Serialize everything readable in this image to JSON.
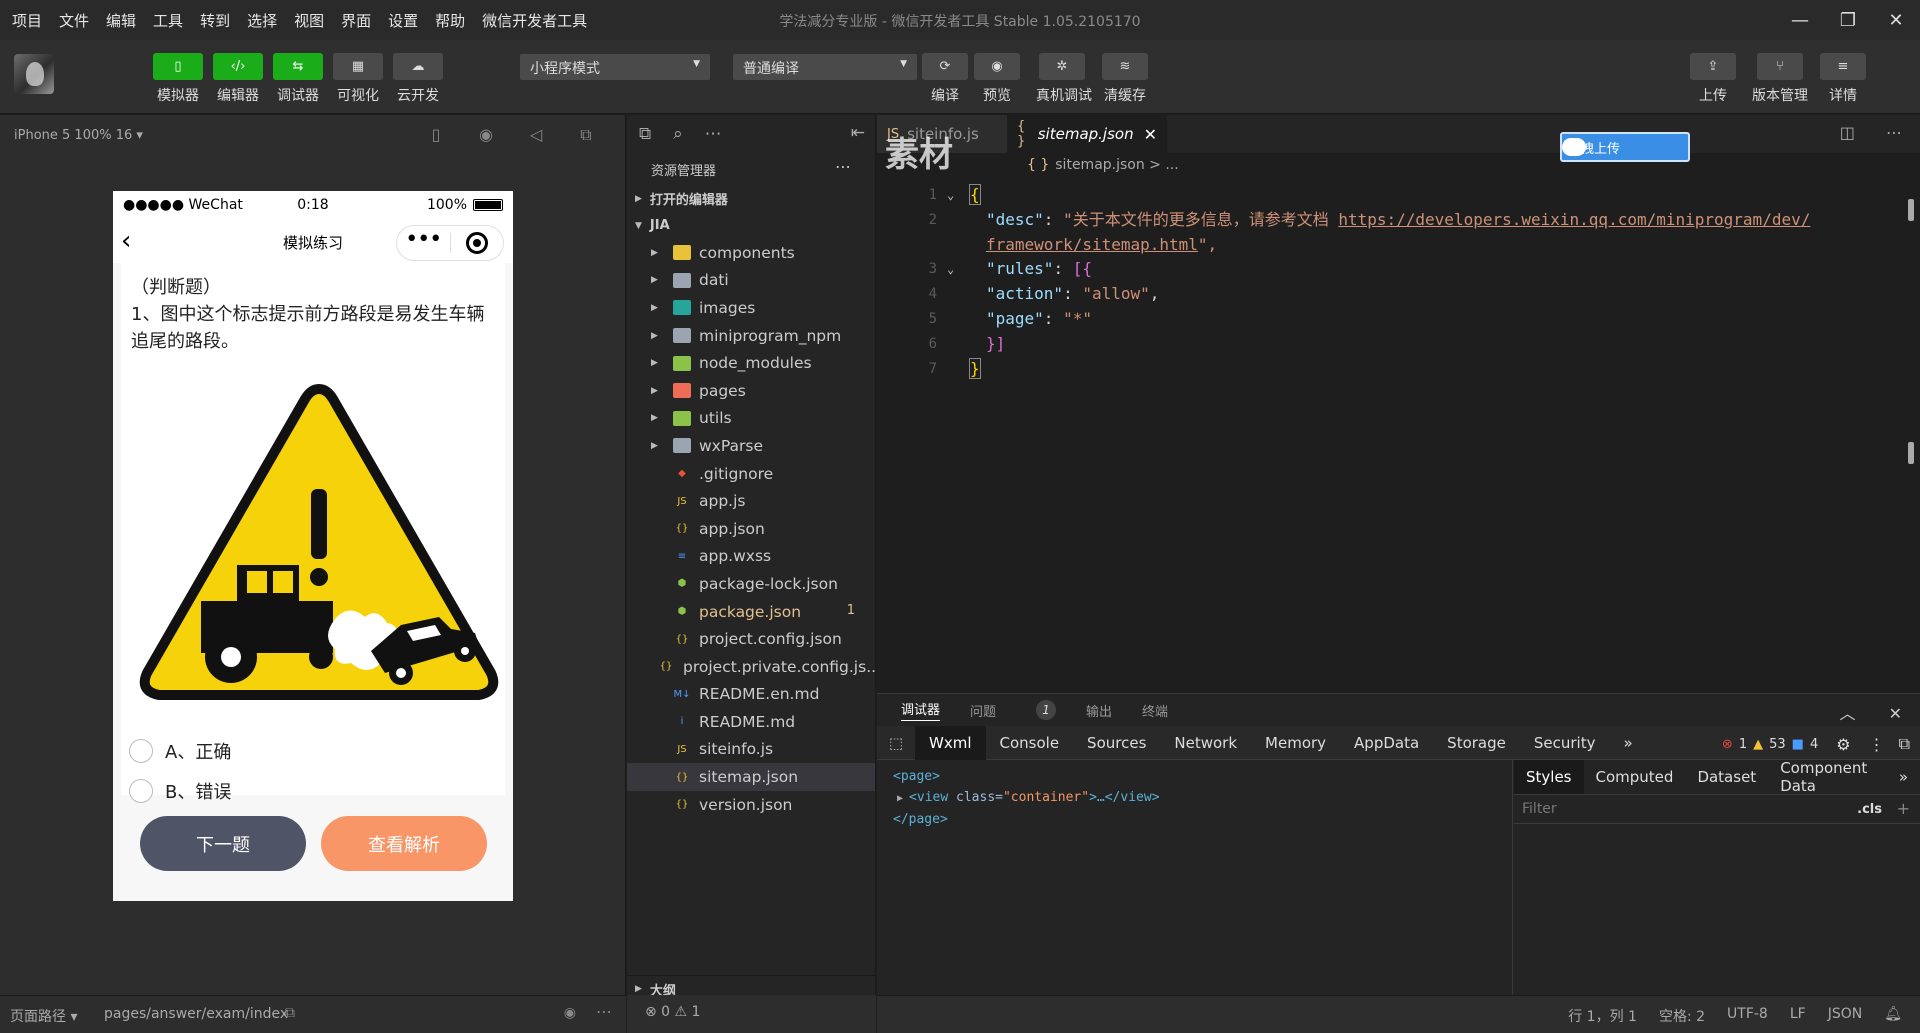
{
  "menubar": {
    "items": [
      "项目",
      "文件",
      "编辑",
      "工具",
      "转到",
      "选择",
      "视图",
      "界面",
      "设置",
      "帮助",
      "微信开发者工具"
    ],
    "window_title": "学法减分专业版 - 微信开发者工具 Stable 1.05.2105170",
    "controls": {
      "minimize": "—",
      "maximize": "❐",
      "close": "✕"
    }
  },
  "toolbar": {
    "buttons": [
      {
        "label": "模拟器",
        "icon": "phone-icon",
        "glyph": "▯"
      },
      {
        "label": "编辑器",
        "icon": "code-icon",
        "glyph": "‹/›"
      },
      {
        "label": "调试器",
        "icon": "debug-icon",
        "glyph": "⇆"
      },
      {
        "label": "可视化",
        "icon": "layout-icon",
        "glyph": "▦"
      },
      {
        "label": "云开发",
        "icon": "cloud-icon",
        "glyph": "☁"
      }
    ],
    "mode_select": "小程序模式",
    "compile_select": "普通编译",
    "actions": [
      {
        "label": "编译",
        "icon": "refresh-icon",
        "glyph": "⟳"
      },
      {
        "label": "预览",
        "icon": "eye-icon",
        "glyph": "◉"
      },
      {
        "label": "真机调试",
        "icon": "bug-icon",
        "glyph": "✲"
      },
      {
        "label": "清缓存",
        "icon": "layers-icon",
        "glyph": "≋"
      }
    ],
    "right_actions": [
      {
        "label": "上传",
        "icon": "upload-icon",
        "glyph": "⇪"
      },
      {
        "label": "版本管理",
        "icon": "branch-icon",
        "glyph": "⑂"
      },
      {
        "label": "详情",
        "icon": "menu-icon",
        "glyph": "≡"
      }
    ]
  },
  "simulator": {
    "device": "iPhone 5 100% 16 ▾",
    "status": {
      "carrier": "●●●●● WeChat",
      "time": "0:18",
      "battery": "100%"
    },
    "nav_title": "模拟练习",
    "question_type": "（判断题）",
    "question": "1、图中这个标志提示前方路段是易发生车辆追尾的路段。",
    "options": [
      "A、正确",
      "B、错误"
    ],
    "next_button": "下一题",
    "analysis_button": "查看解析",
    "footer": {
      "path_label": "页面路径 ▾",
      "path": "pages/answer/exam/index"
    }
  },
  "explorer": {
    "title": "资源管理器",
    "open_editors": "打开的编辑器",
    "project": "JIA",
    "files": [
      {
        "name": "components",
        "type": "folder",
        "color": "#e8c33a"
      },
      {
        "name": "dati",
        "type": "folder",
        "color": "#9aa5b1"
      },
      {
        "name": "images",
        "type": "folder",
        "color": "#26a69a"
      },
      {
        "name": "miniprogram_npm",
        "type": "folder",
        "color": "#9aa5b1"
      },
      {
        "name": "node_modules",
        "type": "folder",
        "color": "#8bc34a"
      },
      {
        "name": "pages",
        "type": "folder",
        "color": "#ef6c57"
      },
      {
        "name": "utils",
        "type": "folder",
        "color": "#8bc34a"
      },
      {
        "name": "wxParse",
        "type": "folder",
        "color": "#9aa5b1"
      },
      {
        "name": ".gitignore",
        "type": "file",
        "color": "#e8533a",
        "glyph": "◆"
      },
      {
        "name": "app.js",
        "type": "file",
        "color": "#e8c33a",
        "glyph": "JS"
      },
      {
        "name": "app.json",
        "type": "file",
        "color": "#e8c33a",
        "glyph": "{}"
      },
      {
        "name": "app.wxss",
        "type": "file",
        "color": "#4a9dff",
        "glyph": "≡"
      },
      {
        "name": "package-lock.json",
        "type": "file",
        "color": "#8bc34a",
        "glyph": "⬢"
      },
      {
        "name": "package.json",
        "type": "file",
        "color": "#8bc34a",
        "glyph": "⬢",
        "modified": true,
        "badge": "1"
      },
      {
        "name": "project.config.json",
        "type": "file",
        "color": "#e8c33a",
        "glyph": "{}"
      },
      {
        "name": "project.private.config.js...",
        "type": "file",
        "color": "#e8c33a",
        "glyph": "{}"
      },
      {
        "name": "README.en.md",
        "type": "file",
        "color": "#4a9dff",
        "glyph": "M↓"
      },
      {
        "name": "README.md",
        "type": "file",
        "color": "#4a9dff",
        "glyph": "i"
      },
      {
        "name": "siteinfo.js",
        "type": "file",
        "color": "#e8c33a",
        "glyph": "JS"
      },
      {
        "name": "sitemap.json",
        "type": "file",
        "color": "#e8c33a",
        "glyph": "{}",
        "selected": true
      },
      {
        "name": "version.json",
        "type": "file",
        "color": "#e8c33a",
        "glyph": "{}"
      }
    ],
    "outline": "大纲",
    "problems": "⊗ 0 ⚠ 1"
  },
  "editor": {
    "inactive_tab": "siteinfo.js",
    "active_tab": "sitemap.json",
    "breadcrumb": "sitemap.json > ...",
    "upload_badge": "拖拽上传",
    "watermark": "素材",
    "lines": {
      "l1": "{",
      "desc_key": "\"desc\"",
      "desc_val": "\"关于本文件的更多信息，请参考文档 ",
      "desc_url1": "https://developers.weixin.qq.com/miniprogram/dev/",
      "desc_url2": "framework/sitemap.html",
      "desc_end": "\",",
      "rules_key": "\"rules\"",
      "rules_open": "[{",
      "action_key": "\"action\"",
      "action_val": "\"allow\"",
      "page_key": "\"page\"",
      "page_val": "\"*\"",
      "rules_close": "}]",
      "l7": "}"
    }
  },
  "devtools": {
    "panel_tabs": [
      "调试器",
      "问题",
      "输出",
      "终端"
    ],
    "problem_count": "1",
    "tabs": [
      "Wxml",
      "Console",
      "Sources",
      "Network",
      "Memory",
      "AppData",
      "Storage",
      "Security"
    ],
    "errors": "1",
    "warnings": "53",
    "infos": "4",
    "wxml": {
      "open": "<page>",
      "view_tag": "<view",
      "view_attr": "class=",
      "view_val": "\"container\"",
      "view_rest": ">…</view>",
      "close": "</page>"
    },
    "style_tabs": [
      "Styles",
      "Computed",
      "Dataset",
      "Component Data"
    ],
    "filter_placeholder": "Filter",
    "cls": ".cls"
  },
  "statusbar": {
    "position": "行 1，列 1",
    "spaces": "空格: 2",
    "encoding": "UTF-8",
    "eol": "LF",
    "language": "JSON"
  }
}
